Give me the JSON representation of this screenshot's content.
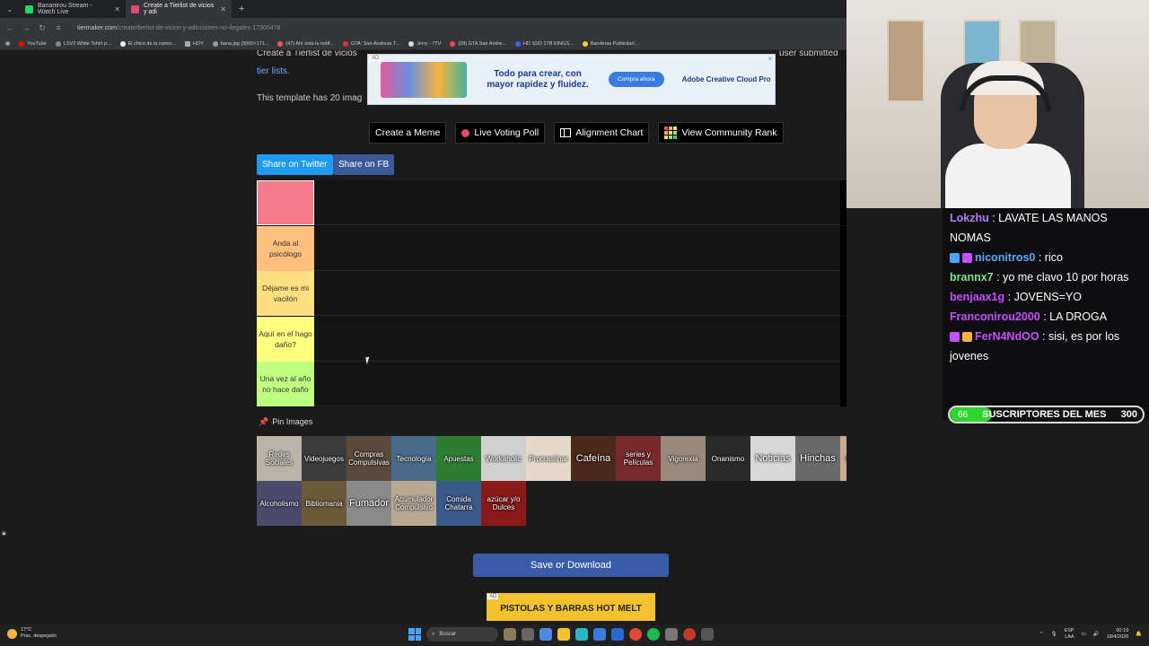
{
  "browser": {
    "tabs": [
      {
        "label": "Bananirou Stream - Watch Live",
        "active": false,
        "color": "#1bd96a"
      },
      {
        "label": "Create a Tierlist de vicios y adi",
        "active": true,
        "color": "#e84a6b"
      }
    ],
    "url": "tiermaker.com",
    "url_path": "/create/tierlist-de-vicios-y-adicciones-no-ilegales-17300478",
    "bookmarks": [
      "YouTube",
      "LSV2 White Tshirt p...",
      "El chico de la camis...",
      "HOY",
      "bana.jpg (3000×171...",
      "(47) Ahí esta la notif...",
      "GTA: San Andreas T...",
      "Jerry - 7TV",
      "(28) GTA San Andre...",
      "HD SSD 1TB KINGS...",
      "Banderas Publicitari..."
    ]
  },
  "page": {
    "intro_line": "Create a Tierlist de vicios",
    "intro_tail": "user submitted",
    "intro_link": "tier lists.",
    "template_count_text": "This template has 20 imag",
    "ad_top": {
      "tag": "AD",
      "text": "Todo para crear, con mayor rapidez y fluidez.",
      "button": "Compra ahora",
      "brand": "Adobe Creative Cloud Pro"
    },
    "buttons": {
      "meme": "Create a Meme",
      "poll": "Live Voting Poll",
      "alignment": "Alignment Chart",
      "community": "View Community Rank"
    },
    "share": {
      "twitter": "Share on Twitter",
      "fb": "Share on FB"
    },
    "tiers": [
      {
        "label": "",
        "color": "#f47c8a"
      },
      {
        "label": "Anda al psicólogo",
        "color": "#ffbf7f"
      },
      {
        "label": "Déjame es mi vacilón",
        "color": "#ffdf80"
      },
      {
        "label": "Aquí en el hago daño?",
        "color": "#ffff7f"
      },
      {
        "label": "Una vez al año no hace daño",
        "color": "#bfff7f"
      }
    ],
    "pin_images_label": "Pin Images",
    "pool_items": [
      {
        "label": "Redes Sociales",
        "color": "#b9b3a8",
        "big": false
      },
      {
        "label": "Videojuegos",
        "color": "#3b3b3b",
        "big": false
      },
      {
        "label": "Compras Compulsivas",
        "color": "#5a4a3a",
        "big": false
      },
      {
        "label": "Tecnología",
        "color": "#4a6a8a",
        "big": false
      },
      {
        "label": "Apuestas",
        "color": "#2e7d32",
        "big": false
      },
      {
        "label": "Workaholic",
        "color": "#cfcfcf",
        "big": false
      },
      {
        "label": "Procrastinar",
        "color": "#e6d8c8",
        "big": false
      },
      {
        "label": "Cafeína",
        "color": "#4a2a1a",
        "big": true
      },
      {
        "label": "series y Películas",
        "color": "#7a2a2a",
        "big": false
      },
      {
        "label": "Vigorexia",
        "color": "#9a8a7a",
        "big": false
      },
      {
        "label": "Onanismo",
        "color": "#2a2a2a",
        "big": false
      },
      {
        "label": "Noticias",
        "color": "#d8d8d8",
        "big": true
      },
      {
        "label": "Hinchas",
        "color": "#6a6a6a",
        "big": true
      },
      {
        "label": "Melómano",
        "color": "#c8a890",
        "big": false
      },
      {
        "label": "Alcoholismo",
        "color": "#4a4a6a",
        "big": false
      },
      {
        "label": "Bibliomania",
        "color": "#6a5a3a",
        "big": false
      },
      {
        "label": "Fumador",
        "color": "#8a8a8a",
        "big": true
      },
      {
        "label": "Acumulador Compulsivo",
        "color": "#b8a890",
        "big": false
      },
      {
        "label": "Comida Chatarra",
        "color": "#3a5a8a",
        "big": false
      },
      {
        "label": "azúcar y/o Dulces",
        "color": "#8a1a1a",
        "big": false
      }
    ],
    "save_button": "Save or Download",
    "ad_bottom": {
      "tag": "AD",
      "text": "PISTOLAS Y BARRAS HOT MELT"
    }
  },
  "chat": {
    "messages": [
      {
        "user": "Lokzhu",
        "color": "#b57bff",
        "text": "LAVATE LAS MANOS NOMAS",
        "badges": []
      },
      {
        "user": "niconitros0",
        "color": "#5fa8ff",
        "text": "rico",
        "badges": [
          "#4aa3ff",
          "#c64fff"
        ]
      },
      {
        "user": "brannx7",
        "color": "#7fe08f",
        "text": "yo me clavo 10 por horas",
        "badges": []
      },
      {
        "user": "benjaax1g",
        "color": "#c64fff",
        "text": "JOVENS=YO",
        "badges": []
      },
      {
        "user": "Franconirou2000",
        "color": "#c64fff",
        "text": "LA DROGA",
        "badges": []
      },
      {
        "user": "FerN4NdOO",
        "color": "#c64fff",
        "text": "sisi, es por los jovenes",
        "badges": [
          "#c64fff",
          "#f3b33d"
        ]
      }
    ],
    "sub_goal": {
      "current": "66",
      "label": "SUSCRIPTORES DEL MES",
      "goal": "300",
      "progress": 0.22
    }
  },
  "taskbar": {
    "weather_temp": "17°C",
    "weather_desc": "Prac. despejado",
    "search_placeholder": "Buscar",
    "lang": "ESP",
    "lang2": "LAA",
    "time": "00:19",
    "date": "18/4/2026"
  }
}
